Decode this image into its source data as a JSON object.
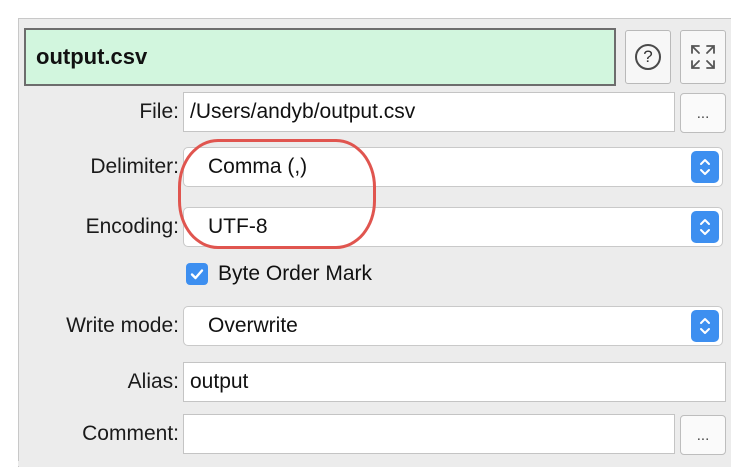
{
  "header": {
    "name_value": "output.csv",
    "help_icon": "question-circle-icon",
    "expand_icon": "expand-arrows-icon"
  },
  "fields": {
    "file": {
      "label": "File:",
      "value": "/Users/andyb/output.csv",
      "browse_label": "..."
    },
    "delimiter": {
      "label": "Delimiter:",
      "value": "Comma (,)"
    },
    "encoding": {
      "label": "Encoding:",
      "value": "UTF-8"
    },
    "bom": {
      "label": "Byte Order Mark",
      "checked": true
    },
    "write_mode": {
      "label": "Write mode:",
      "value": "Overwrite"
    },
    "alias": {
      "label": "Alias:",
      "value": "output"
    },
    "comment": {
      "label": "Comment:",
      "value": "",
      "browse_label": "..."
    }
  },
  "colors": {
    "name_field_bg": "#d2f6de",
    "accent": "#3d8ff0",
    "annotation": "#e0554f"
  }
}
